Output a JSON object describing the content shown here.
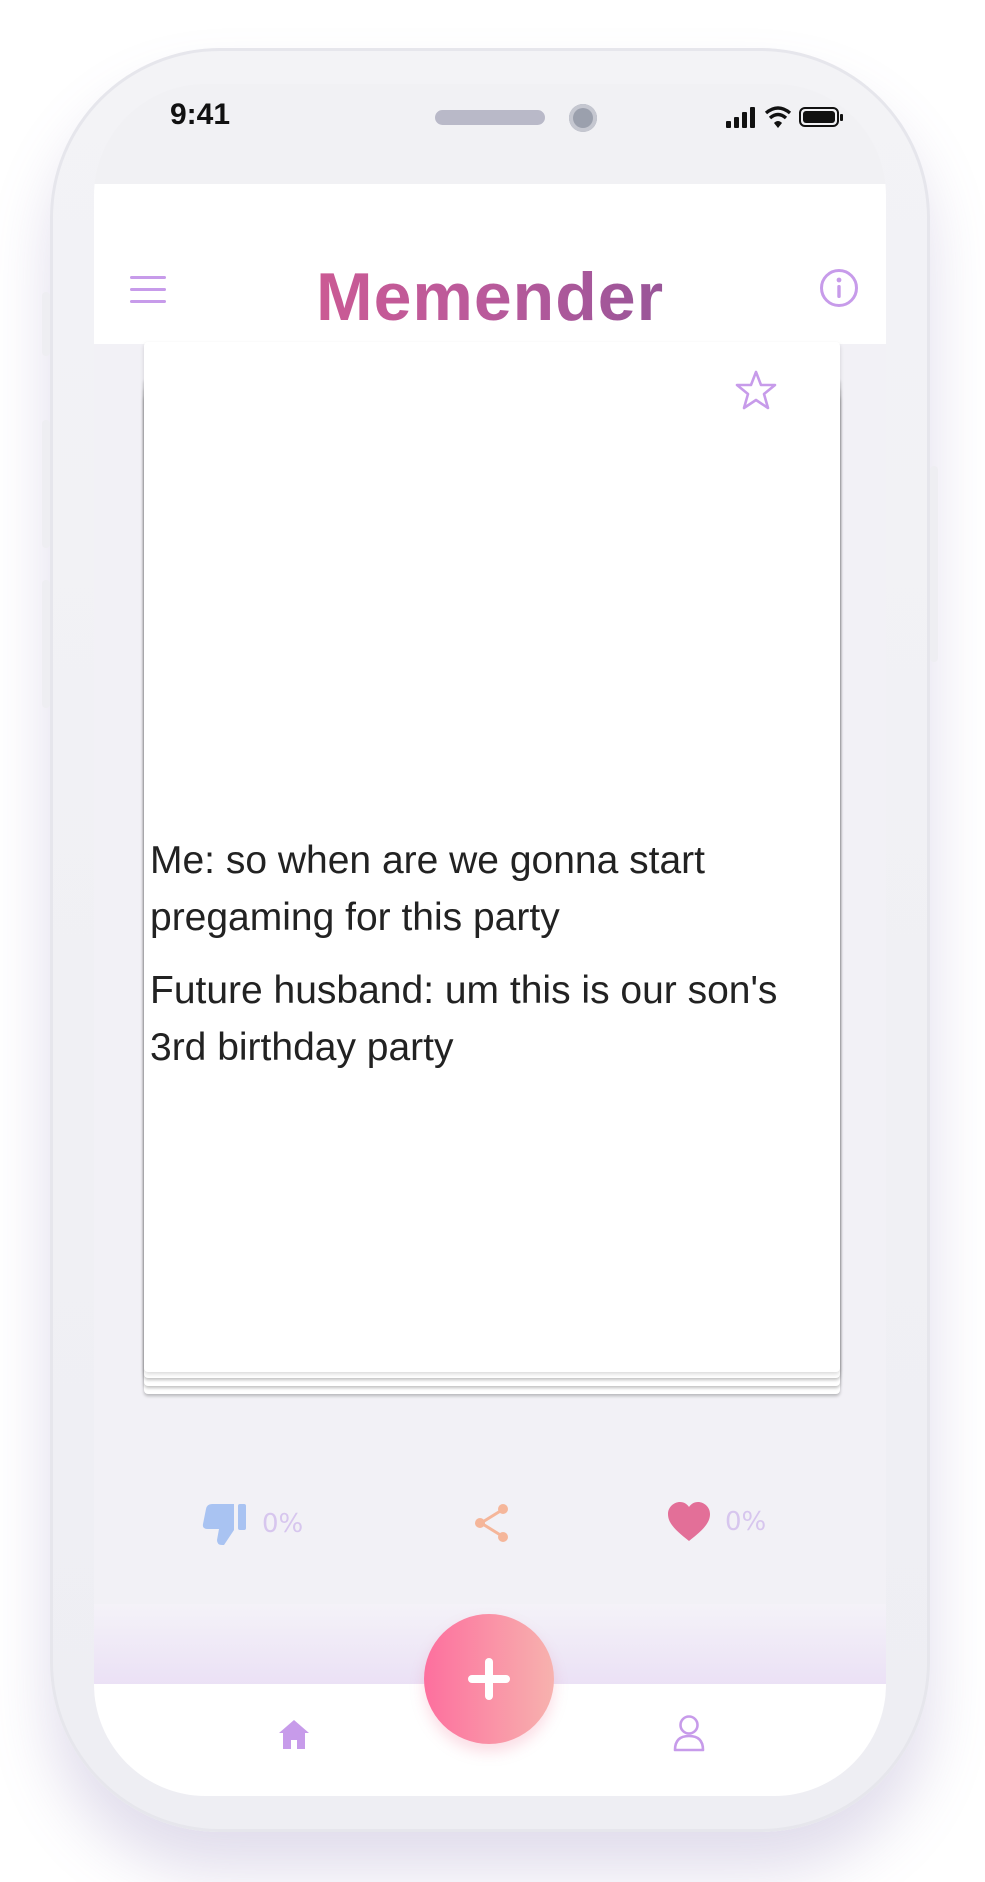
{
  "status_bar": {
    "time": "9:41"
  },
  "header": {
    "title": "Memender",
    "menu_icon": "hamburger-menu-icon",
    "info_icon": "info-circle-icon",
    "title_gradient": [
      "#e15b8b",
      "#6e4f95"
    ]
  },
  "card": {
    "favorite_icon": "star-outline-icon",
    "meme_lines": [
      "Me: so when are we gonna start pregaming for this party",
      "Future husband: um this is our son's 3rd birthday party"
    ],
    "dislike": {
      "icon": "thumbs-down-icon",
      "percent": "0%",
      "color": "#a9c3f2"
    },
    "share": {
      "icon": "share-icon",
      "color": "#f5b69a"
    },
    "like": {
      "icon": "heart-icon",
      "percent": "0%",
      "color": "#e36f98"
    }
  },
  "tabbar": {
    "home_icon": "home-icon",
    "add_icon": "plus-icon",
    "profile_icon": "user-icon",
    "accent": "#c79bea",
    "fab_gradient": [
      "#fd6f9e",
      "#f7b2ae"
    ]
  }
}
